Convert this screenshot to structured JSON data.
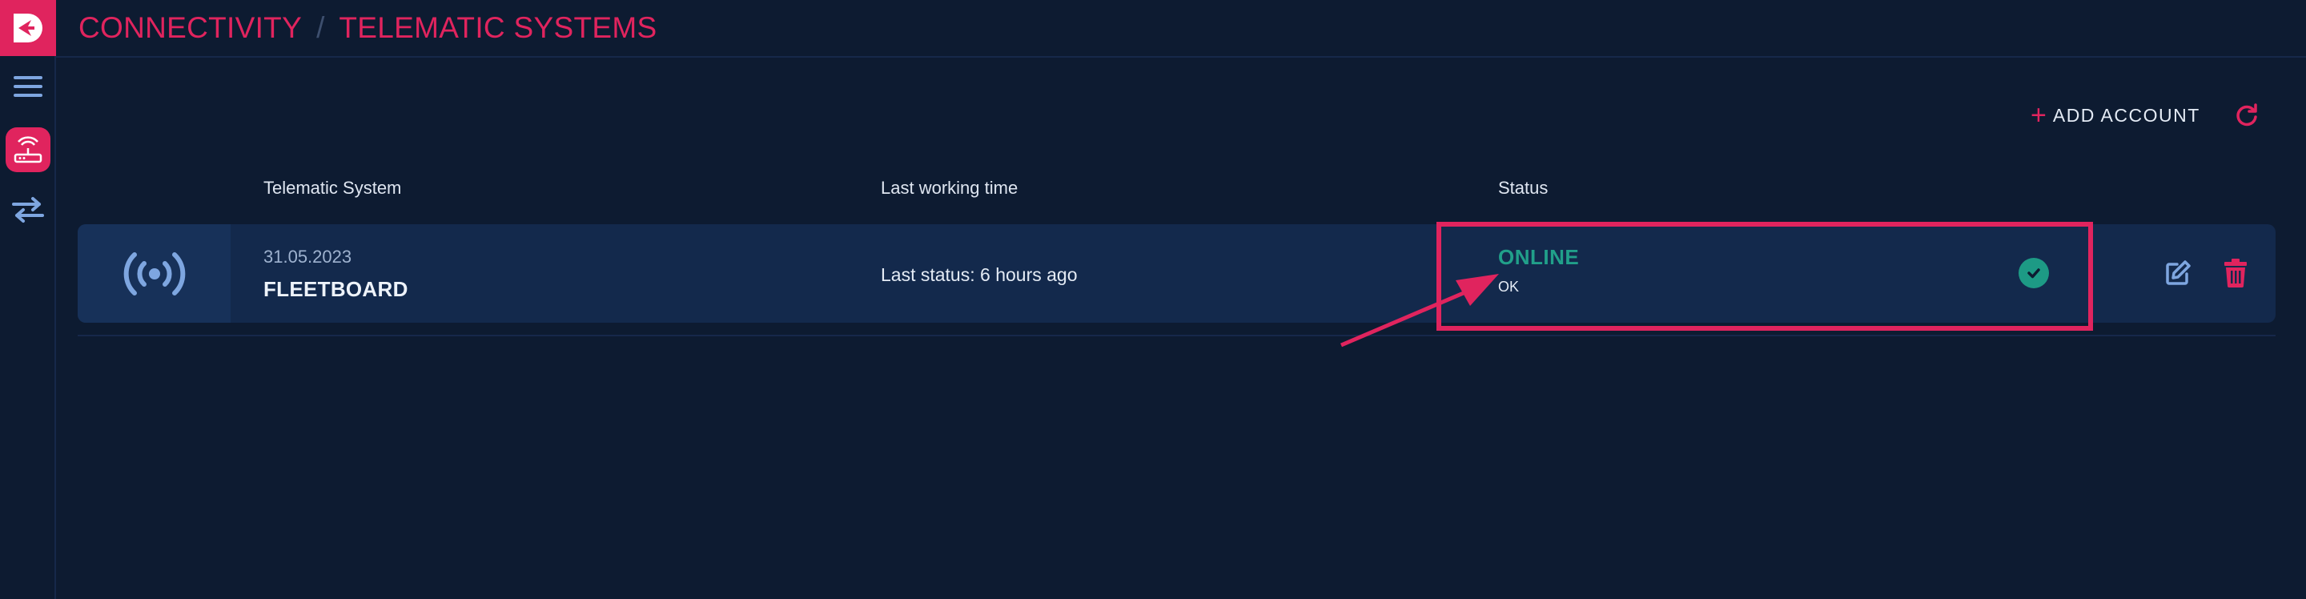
{
  "sidebar": {
    "items": [
      {
        "icon": "menu-icon"
      },
      {
        "icon": "telematic-router-icon",
        "active": true
      },
      {
        "icon": "transfer-arrows-icon"
      }
    ]
  },
  "header": {
    "breadcrumb": [
      "CONNECTIVITY",
      "TELEMATIC SYSTEMS"
    ],
    "separator": "/"
  },
  "toolbar": {
    "add_account_label": "ADD ACCOUNT",
    "add_icon": "plus",
    "refresh_icon": "refresh-icon"
  },
  "table": {
    "columns": [
      "Telematic System",
      "Last working time",
      "Status"
    ],
    "rows": [
      {
        "icon": "broadcast-icon",
        "date": "31.05.2023",
        "name": "FLEETBOARD",
        "last_status": "Last status: 6 hours ago",
        "status": "ONLINE",
        "status_detail": "OK",
        "status_icon": "check-circle-icon"
      }
    ]
  },
  "colors": {
    "accent": "#e0245e",
    "background": "#0d1b31",
    "row": "#13294c",
    "online": "#21a08a"
  }
}
